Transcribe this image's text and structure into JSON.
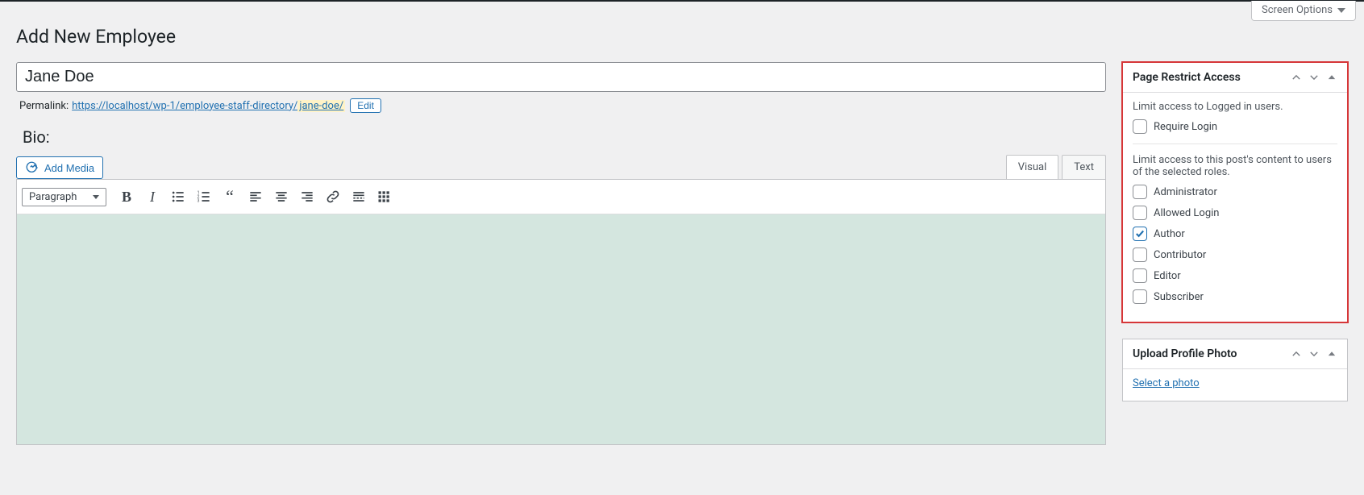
{
  "screen_options_label": "Screen Options",
  "page_title": "Add New Employee",
  "title_value": "Jane Doe",
  "permalink_label": "Permalink:",
  "permalink_base": "https://localhost/wp-1/employee-staff-directory/",
  "permalink_slug": "jane-doe/",
  "edit_slug_label": "Edit",
  "bio_heading": "Bio:",
  "add_media_label": "Add Media",
  "tabs": {
    "visual": "Visual",
    "text": "Text",
    "active": "visual"
  },
  "format_selected": "Paragraph",
  "sidebar": {
    "restrict": {
      "title": "Page Restrict Access",
      "desc1": "Limit access to Logged in users.",
      "require_login_label": "Require Login",
      "desc2": "Limit access to this post's content to users of the selected roles.",
      "roles": [
        {
          "label": "Administrator",
          "checked": false
        },
        {
          "label": "Allowed Login",
          "checked": false
        },
        {
          "label": "Author",
          "checked": true
        },
        {
          "label": "Contributor",
          "checked": false
        },
        {
          "label": "Editor",
          "checked": false
        },
        {
          "label": "Subscriber",
          "checked": false
        }
      ]
    },
    "photo": {
      "title": "Upload Profile Photo",
      "link": "Select a photo"
    }
  }
}
